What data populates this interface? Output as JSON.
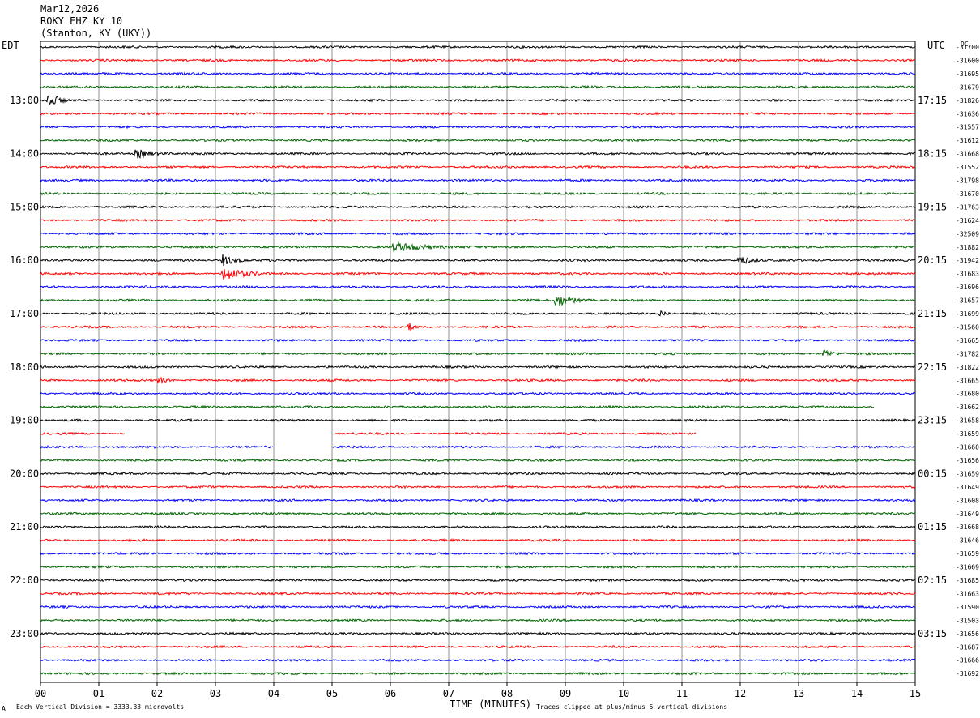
{
  "header": {
    "date": "Mar12,2026",
    "station": "ROKY EHZ KY 10",
    "location": "(Stanton, KY (UKY))"
  },
  "left_tz": "EDT",
  "right_tz": "UTC",
  "right_corner": "DC",
  "footer": {
    "division_note": "Each Vertical Division = 3333.33 microvolts",
    "xlabel": "TIME (MINUTES)",
    "clip_note": "Traces clipped at plus/minus 5 vertical divisions",
    "corner_mark": "A"
  },
  "colors": {
    "trace_cycle": [
      "#000000",
      "#ff0000",
      "#0000ff",
      "#006400"
    ],
    "grid": "#000000"
  },
  "chart_data": {
    "type": "line",
    "title": "ROKY EHZ KY 10",
    "xlabel": "TIME (MINUTES)",
    "ylabel": "",
    "xlim": [
      0,
      15
    ],
    "x_ticks": [
      "00",
      "01",
      "02",
      "03",
      "04",
      "05",
      "06",
      "07",
      "08",
      "09",
      "10",
      "11",
      "12",
      "13",
      "14",
      "15"
    ],
    "grid": true,
    "trace_count": 48,
    "left_hour_labels": [
      "13:00",
      "14:00",
      "15:00",
      "16:00",
      "17:00",
      "18:00",
      "19:00",
      "20:00",
      "21:00",
      "22:00",
      "23:00"
    ],
    "right_hour_labels": [
      "17:15",
      "18:15",
      "19:15",
      "20:15",
      "21:15",
      "22:15",
      "23:15",
      "00:15",
      "01:15",
      "02:15",
      "03:15"
    ],
    "dc_offsets": [
      "-31700",
      "-31600",
      "-31695",
      "-31679",
      "-31826",
      "-31636",
      "-31557",
      "-31612",
      "-31668",
      "-31552",
      "-31798",
      "-31670",
      "-31763",
      "-31624",
      "-32509",
      "-31882",
      "-31942",
      "-31683",
      "-31696",
      "-31657",
      "-31699",
      "-31560",
      "-31665",
      "-31782",
      "-31822",
      "-31665",
      "-31680",
      "-31662",
      "-31658",
      "-31659",
      "-31660",
      "-31656",
      "-31659",
      "-31649",
      "-31608",
      "-31649",
      "-31668",
      "-31646",
      "-31659",
      "-31669",
      "-31685",
      "-31663",
      "-31590",
      "-31503",
      "-31656",
      "-31687",
      "-31666",
      "-31692"
    ],
    "events": [
      {
        "trace": 4,
        "start_min": 0.1,
        "end_min": 0.45,
        "amp": 1.0
      },
      {
        "trace": 8,
        "start_min": 1.6,
        "end_min": 2.3,
        "amp": 0.45
      },
      {
        "trace": 16,
        "start_min": 3.1,
        "end_min": 3.6,
        "amp": 0.55
      },
      {
        "trace": 17,
        "start_min": 3.1,
        "end_min": 3.8,
        "amp": 0.8
      },
      {
        "trace": 16,
        "start_min": 11.95,
        "end_min": 12.4,
        "amp": 0.55
      },
      {
        "trace": 19,
        "start_min": 8.8,
        "end_min": 9.5,
        "amp": 0.65
      },
      {
        "trace": 15,
        "start_min": 6.0,
        "end_min": 7.5,
        "amp": 0.4
      },
      {
        "trace": 23,
        "start_min": 13.4,
        "end_min": 13.8,
        "amp": 0.45
      },
      {
        "trace": 21,
        "start_min": 6.3,
        "end_min": 6.5,
        "amp": 0.45
      },
      {
        "trace": 20,
        "start_min": 10.6,
        "end_min": 10.9,
        "amp": 0.35
      },
      {
        "trace": 25,
        "start_min": 2.0,
        "end_min": 2.3,
        "amp": 0.35
      }
    ],
    "gaps": [
      {
        "trace": 29,
        "start_min": 1.45,
        "end_min": 5.0
      },
      {
        "trace": 29,
        "start_min": 11.25,
        "end_min": 15.0
      },
      {
        "trace": 30,
        "start_min": 4.0,
        "end_min": 5.0
      },
      {
        "trace": 27,
        "start_min": 14.3,
        "end_min": 15.0
      }
    ]
  }
}
